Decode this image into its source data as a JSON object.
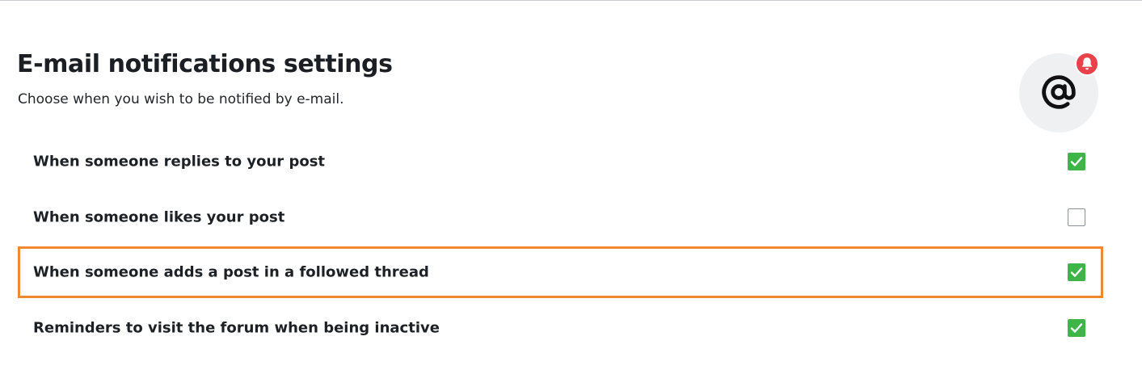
{
  "header": {
    "title": "E-mail notifications settings",
    "subtitle": "Choose when you wish to be notified by e-mail."
  },
  "icons": {
    "main": "at-sign-icon",
    "badge": "bell-icon"
  },
  "colors": {
    "checked": "#3eb449",
    "highlight_border": "#f08a32",
    "badge": "#e8434b",
    "icon_circle": "#eff0f2"
  },
  "settings": [
    {
      "label": "When someone replies to your post",
      "checked": true,
      "highlighted": false
    },
    {
      "label": "When someone likes your post",
      "checked": false,
      "highlighted": false
    },
    {
      "label": "When someone adds a post in a followed thread",
      "checked": true,
      "highlighted": true
    },
    {
      "label": "Reminders to visit the forum when being inactive",
      "checked": true,
      "highlighted": false
    }
  ]
}
